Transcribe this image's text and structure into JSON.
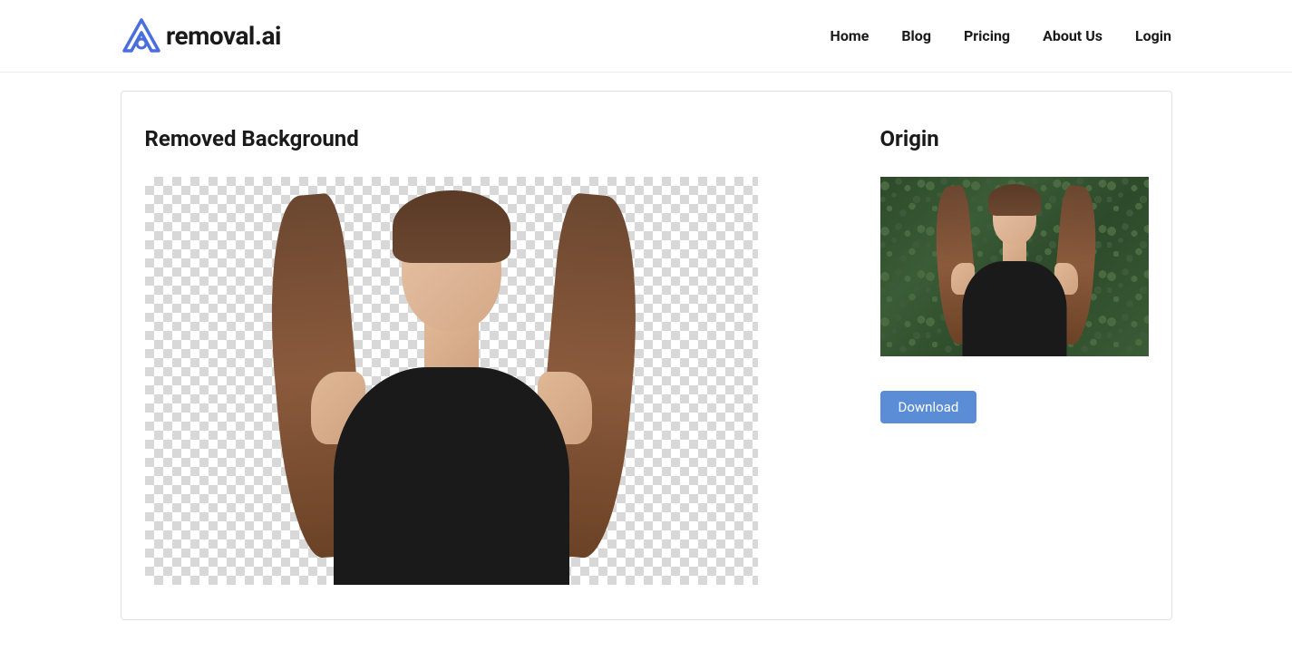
{
  "brand": {
    "name": "removal.ai",
    "logo_color": "#4a6edb"
  },
  "nav": {
    "items": [
      {
        "label": "Home"
      },
      {
        "label": "Blog"
      },
      {
        "label": "Pricing"
      },
      {
        "label": "About Us"
      },
      {
        "label": "Login"
      }
    ]
  },
  "main": {
    "removed_title": "Removed Background",
    "origin_title": "Origin",
    "download_label": "Download"
  },
  "colors": {
    "accent": "#5a8dd6",
    "logo": "#4a6edb",
    "text": "#1a1a1a",
    "border": "#e2e2e2"
  }
}
